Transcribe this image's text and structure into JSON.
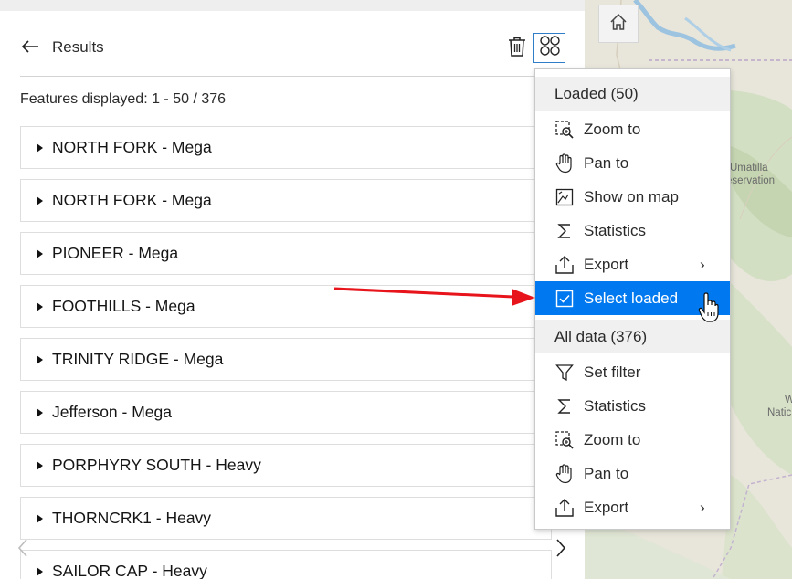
{
  "map": {
    "home_icon": "home-icon",
    "labels": [
      "Umatilla",
      "eservation",
      "W",
      "Natic"
    ]
  },
  "panel": {
    "title": "Results",
    "back_icon": "arrow-left-icon",
    "delete_icon": "trash-icon",
    "options_icon": "grid-circles-icon",
    "features_displayed": "Features displayed: 1 - 50 / 376",
    "items": [
      "NORTH FORK - Mega",
      "NORTH FORK - Mega",
      "PIONEER - Mega",
      "FOOTHILLS - Mega",
      "TRINITY RIDGE - Mega",
      "Jefferson - Mega",
      "PORPHYRY SOUTH - Heavy",
      "THORNCRK1 - Heavy",
      "SAILOR CAP - Heavy"
    ]
  },
  "menu": {
    "loaded_header": "Loaded (50)",
    "loaded_items": [
      {
        "label": "Zoom to",
        "icon": "zoom-to-icon"
      },
      {
        "label": "Pan to",
        "icon": "hand-icon"
      },
      {
        "label": "Show on map",
        "icon": "show-on-map-icon"
      },
      {
        "label": "Statistics",
        "icon": "sigma-icon"
      },
      {
        "label": "Export",
        "icon": "export-icon",
        "chevron": "›"
      },
      {
        "label": "Select loaded",
        "icon": "checkbox-icon",
        "active": true
      }
    ],
    "all_header": "All data (376)",
    "all_items": [
      {
        "label": "Set filter",
        "icon": "filter-icon"
      },
      {
        "label": "Statistics",
        "icon": "sigma-icon"
      },
      {
        "label": "Zoom to",
        "icon": "zoom-to-icon"
      },
      {
        "label": "Pan to",
        "icon": "hand-icon"
      },
      {
        "label": "Export",
        "icon": "export-icon",
        "chevron": "›"
      }
    ]
  },
  "colors": {
    "accent": "#0079f0",
    "options_border": "#2f7dc8",
    "arrow": "#e8141b"
  }
}
